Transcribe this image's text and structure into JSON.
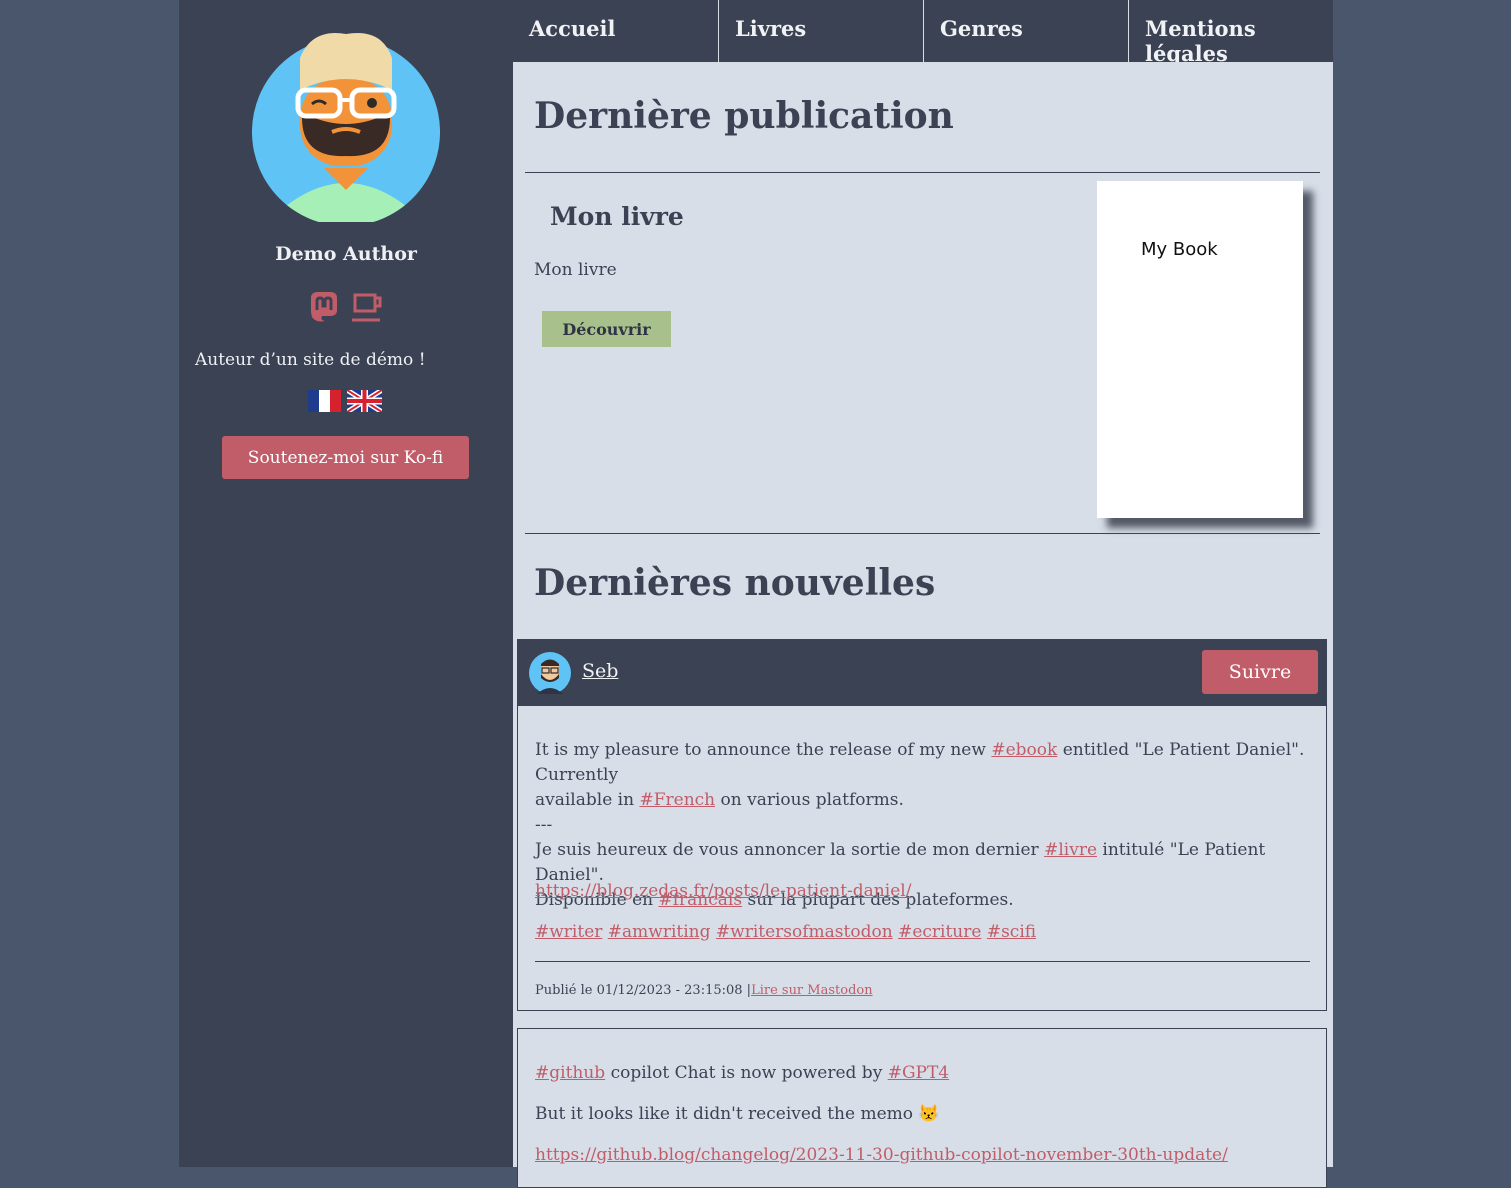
{
  "sidebar": {
    "author_name": "Demo Author",
    "bio": "Auteur d’un site de démo !",
    "icons": [
      "mastodon-icon",
      "coffee-cup-icon"
    ],
    "flags": [
      "france-flag-icon",
      "uk-flag-icon"
    ],
    "kofi_label": "Soutenez-moi sur Ko-fi"
  },
  "nav": {
    "items": [
      "Accueil",
      "Livres",
      "Genres",
      "Mentions légales"
    ]
  },
  "latest_publication": {
    "heading": "Dernière publication",
    "book_title": "Mon livre",
    "book_description": "Mon livre",
    "discover_label": "Découvrir",
    "cover_label": "My Book"
  },
  "news": {
    "heading": "Dernières nouvelles",
    "account_name": "Seb",
    "follow_label": "Suivre",
    "post1": {
      "line1_a": "It is my pleasure to announce the release of my new ",
      "line1_tag": "#ebook",
      "line1_b": " entitled \"Le Patient Daniel\". Currently",
      "line2_a": "available in ",
      "line2_tag": "#French",
      "line2_b": " on various platforms.",
      "separator": "---",
      "line3_a": "Je suis heureux de vous annoncer la sortie de mon dernier ",
      "line3_tag": "#livre",
      "line3_b": " intitulé \"Le Patient Daniel\".",
      "line4_a": "Disponible en ",
      "line4_tag": "#francais",
      "line4_b": " sur la plupart des plateformes.",
      "url": "https://blog.zedas.fr/posts/le-patient-daniel/",
      "tags": [
        "#writer",
        "#amwriting",
        "#writersofmastodon",
        "#ecriture",
        "#scifi"
      ],
      "published": "Publié le 01/12/2023 - 23:15:08 |",
      "read_on": "Lire sur Mastodon"
    },
    "post2": {
      "tag1": "#github",
      "text1": " copilot Chat is now powered by ",
      "tag2": "#GPT4",
      "line2": "But it looks like it didn't received the memo",
      "emoji": "😾",
      "url": "https://github.blog/changelog/2023-11-30-github-copilot-november-30th-update/"
    }
  },
  "colors": {
    "page_bg": "#4a566c",
    "sidebar_bg": "#3b4253",
    "content_bg": "#d8dee8",
    "accent": "#c05d68",
    "button_green": "#a8c08b"
  }
}
